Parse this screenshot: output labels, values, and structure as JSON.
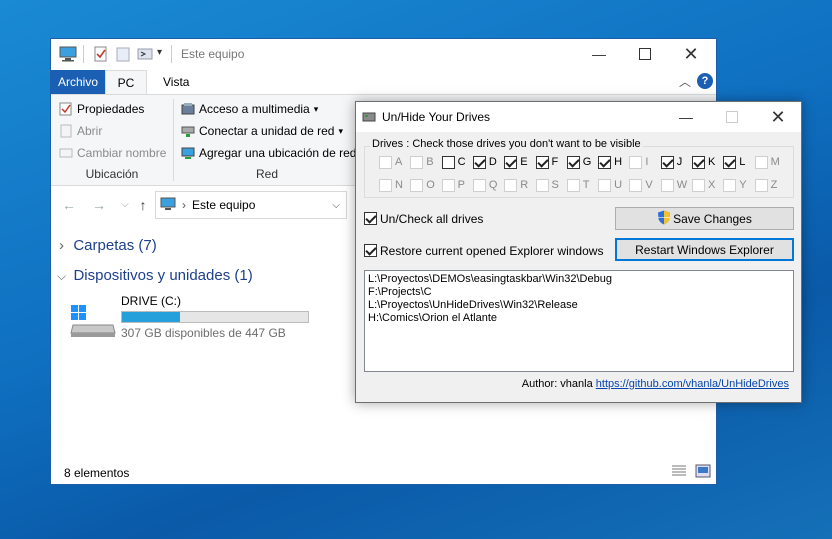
{
  "explorer": {
    "title": "Este equipo",
    "tabs": [
      "Archivo",
      "PC",
      "Vista"
    ],
    "ribbon": {
      "ubicacion": {
        "items": [
          "Propiedades",
          "Abrir",
          "Cambiar nombre"
        ],
        "label": "Ubicación"
      },
      "red": {
        "items": [
          "Acceso a multimedia",
          "Conectar a unidad de red",
          "Agregar una ubicación de red"
        ],
        "label": "Red"
      }
    },
    "address": "Este equipo",
    "sections": [
      "Carpetas (7)",
      "Dispositivos y unidades (1)"
    ],
    "drive": {
      "name": "DRIVE (C:)",
      "free": "307 GB disponibles de 447 GB",
      "used_fraction": 0.31
    },
    "status": "8 elementos"
  },
  "dialog": {
    "title": "Un/Hide Your Drives",
    "drives_label": "Drives : Check those drives you don't want to be visible",
    "drives_row1": [
      {
        "letter": "A",
        "checked": false,
        "enabled": false
      },
      {
        "letter": "B",
        "checked": false,
        "enabled": false
      },
      {
        "letter": "C",
        "checked": false,
        "enabled": true
      },
      {
        "letter": "D",
        "checked": true,
        "enabled": true
      },
      {
        "letter": "E",
        "checked": true,
        "enabled": true
      },
      {
        "letter": "F",
        "checked": true,
        "enabled": true
      },
      {
        "letter": "G",
        "checked": true,
        "enabled": true
      },
      {
        "letter": "H",
        "checked": true,
        "enabled": true
      },
      {
        "letter": "I",
        "checked": false,
        "enabled": false
      },
      {
        "letter": "J",
        "checked": true,
        "enabled": true
      },
      {
        "letter": "K",
        "checked": true,
        "enabled": true
      },
      {
        "letter": "L",
        "checked": true,
        "enabled": true
      },
      {
        "letter": "M",
        "checked": false,
        "enabled": false
      }
    ],
    "drives_row2": [
      {
        "letter": "N",
        "checked": false,
        "enabled": false
      },
      {
        "letter": "O",
        "checked": false,
        "enabled": false
      },
      {
        "letter": "P",
        "checked": false,
        "enabled": false
      },
      {
        "letter": "Q",
        "checked": false,
        "enabled": false
      },
      {
        "letter": "R",
        "checked": false,
        "enabled": false
      },
      {
        "letter": "S",
        "checked": false,
        "enabled": false
      },
      {
        "letter": "T",
        "checked": false,
        "enabled": false
      },
      {
        "letter": "U",
        "checked": false,
        "enabled": false
      },
      {
        "letter": "V",
        "checked": false,
        "enabled": false
      },
      {
        "letter": "W",
        "checked": false,
        "enabled": false
      },
      {
        "letter": "X",
        "checked": false,
        "enabled": false
      },
      {
        "letter": "Y",
        "checked": false,
        "enabled": false
      },
      {
        "letter": "Z",
        "checked": false,
        "enabled": false
      }
    ],
    "uncheck_all_label": "Un/Check all drives",
    "uncheck_all_checked": true,
    "restore_label": "Restore current opened Explorer windows",
    "restore_checked": true,
    "save_button": "Save Changes",
    "restart_button": "Restart Windows Explorer",
    "paths": [
      "L:\\Proyectos\\DEMOs\\easingtaskbar\\Win32\\Debug",
      "F:\\Projects\\C",
      "L:\\Proyectos\\UnHideDrives\\Win32\\Release",
      "H:\\Comics\\Orion el Atlante"
    ],
    "author_label": "Author: vhanla",
    "author_link": "https://github.com/vhanla/UnHideDrives"
  },
  "colors": {
    "accent": "#1a5fb4",
    "link": "#0645ad",
    "progress": "#26a0da",
    "desktop": "#0f6fc0"
  }
}
